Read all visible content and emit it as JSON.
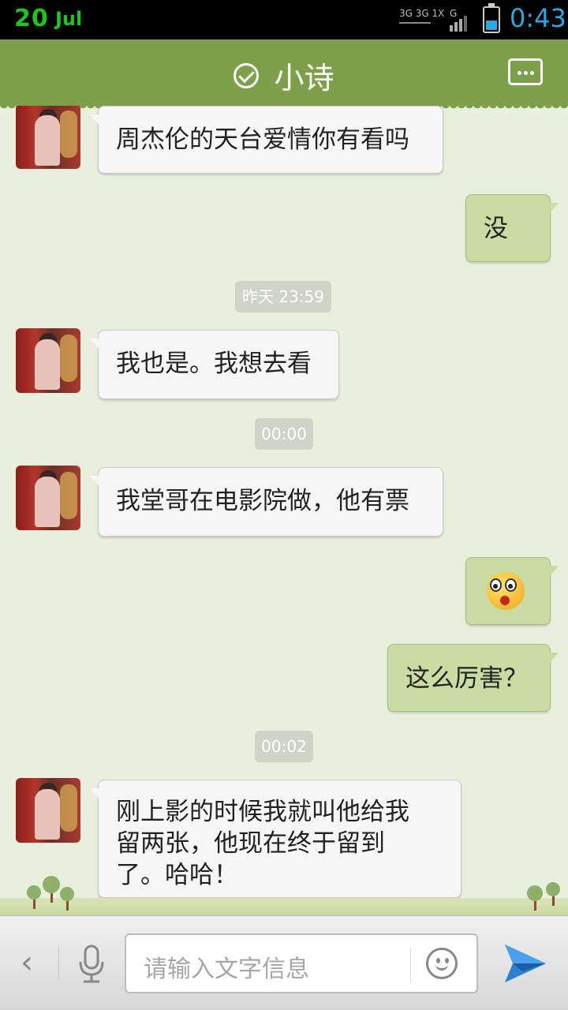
{
  "status_bar": {
    "date_day": "20",
    "date_month": "Jul",
    "network": "3G",
    "time": "0:43",
    "battery_level": 0.35
  },
  "header": {
    "title": "小诗",
    "verified_icon": "check-circle-icon",
    "menu_icon": "more-dots-icon"
  },
  "messages": [
    {
      "type": "text",
      "direction": "in",
      "text": "周杰伦的天台爱情你有看吗"
    },
    {
      "type": "text",
      "direction": "out",
      "text": "没"
    },
    {
      "type": "time",
      "text": "昨天 23:59"
    },
    {
      "type": "text",
      "direction": "in",
      "text": "我也是。我想去看"
    },
    {
      "type": "time",
      "text": "00:00"
    },
    {
      "type": "text",
      "direction": "in",
      "text": "我堂哥在电影院做，他有票"
    },
    {
      "type": "emoji",
      "direction": "out",
      "emoji": "surprised-face-icon"
    },
    {
      "type": "text",
      "direction": "out",
      "text": "这么厉害？"
    },
    {
      "type": "time",
      "text": "00:02"
    },
    {
      "type": "text",
      "direction": "in",
      "lines": [
        "刚上影的时候我就叫他给我",
        "留两张，他现在终于留到",
        "了。哈哈！"
      ]
    }
  ],
  "input_bar": {
    "back_icon": "chevron-left-icon",
    "mic_icon": "microphone-icon",
    "placeholder": "请输入文字信息",
    "emoji_icon": "smiley-icon",
    "send_icon": "send-icon"
  },
  "colors": {
    "header_bg": "#7fa04a",
    "chat_bg": "#e8efdc",
    "outgoing_bubble": "#c8dca4",
    "incoming_bubble": "#f6f6f6",
    "time_accent": "#2ea6e0"
  }
}
